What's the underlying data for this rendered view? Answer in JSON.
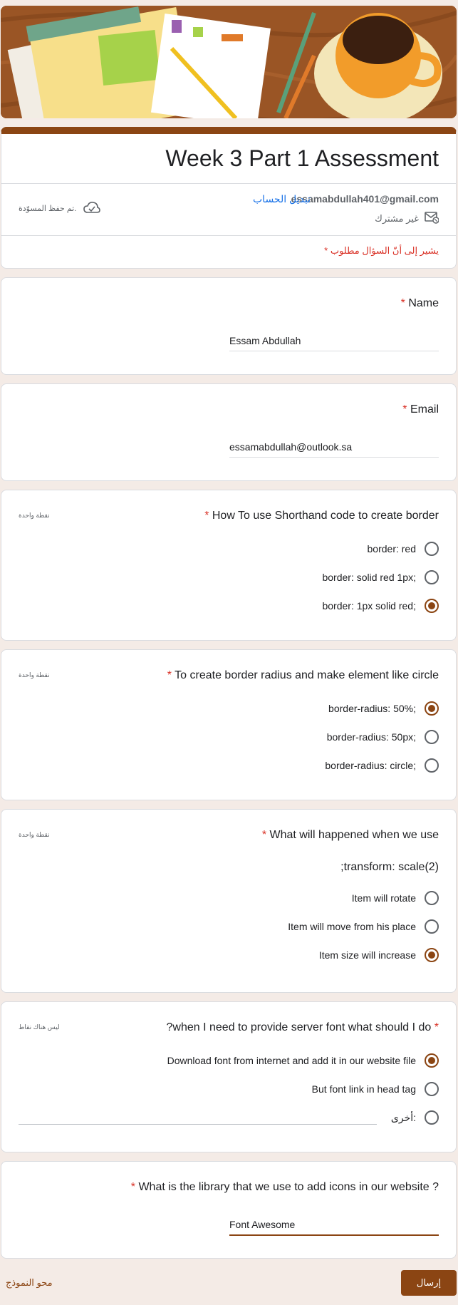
{
  "form": {
    "title": "Week 3 Part 1 Assessment",
    "account_email": "essamabdullah401@gmail.com",
    "switch_account": "تبديل الحساب",
    "not_shared": "غير مشترك",
    "draft_saved": "تم حفظ المسوّدة.",
    "required_note": "* يشير إلى أنّ السؤال مطلوب"
  },
  "questions": [
    {
      "title": "Name",
      "star": "*",
      "answer": "Essam Abdullah"
    },
    {
      "title": "Email",
      "star": "*",
      "answer": "essamabdullah@outlook.sa"
    },
    {
      "title": "How To use Shorthand code to create border",
      "star": "*",
      "points": "نقطة واحدة",
      "options": [
        "border: red",
        "border: solid red 1px;",
        "border: 1px solid red;"
      ],
      "selected": 2
    },
    {
      "title": " To create border radius and make element like circle",
      "star": "*",
      "points": "نقطة واحدة",
      "options": [
        "border-radius: 50%;",
        "border-radius: 50px;",
        "border-radius: circle;"
      ],
      "selected": 0
    },
    {
      "title": "What will happened when we use",
      "star": "*",
      "points": "نقطة واحدة",
      "subtitle": "transform: scale(2);",
      "options": [
        "Item will rotate",
        "Item will move from his place",
        "Item size will increase"
      ],
      "selected": 2
    },
    {
      "title": "when I need to provide server font what should I do?",
      "star": "*",
      "points": "ليس هناك نقاط",
      "options": [
        "Download font from internet and add it in our website file",
        "But font link in head tag",
        "أخرى:"
      ],
      "selected": 0
    },
    {
      "title": "What is the library that we use to add icons in our website ?",
      "star": "*",
      "answer": "Font Awesome"
    }
  ],
  "footer": {
    "submit": "إرسال",
    "clear": "محو النموذج"
  },
  "colors": {
    "accent": "#8b4513",
    "required": "#d93025",
    "background": "#f4ebe6"
  },
  "icons": [
    "cloud-check-icon",
    "mail-not-shared-icon"
  ]
}
